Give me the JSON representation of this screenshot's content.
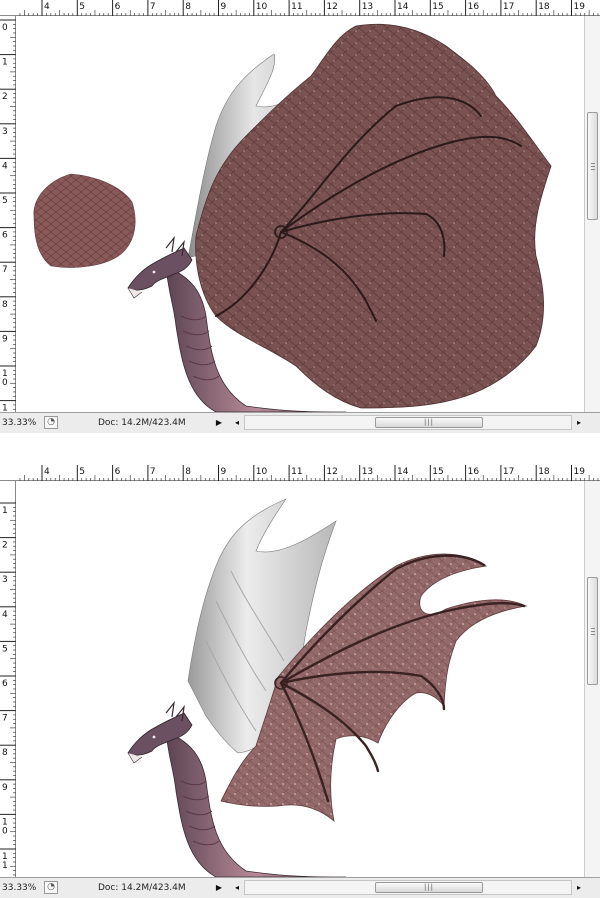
{
  "panels": [
    {
      "id": "before",
      "status": {
        "zoom": "33.33%",
        "doc": "Doc: 14.2M/423.4M"
      },
      "ruler_h_labels": [
        "4",
        "5",
        "6",
        "7",
        "8",
        "9",
        "10",
        "11",
        "12",
        "13",
        "14",
        "15",
        "16",
        "17",
        "18",
        "19"
      ],
      "ruler_v_labels": [
        "0",
        "1",
        "2",
        "3",
        "4",
        "5",
        "6",
        "7",
        "8",
        "9",
        "1 0",
        "1 1"
      ]
    },
    {
      "id": "after",
      "status": {
        "zoom": "33.33%",
        "doc": "Doc: 14.2M/423.4M"
      },
      "ruler_h_labels": [
        "4",
        "5",
        "6",
        "7",
        "8",
        "9",
        "10",
        "11",
        "12",
        "13",
        "14",
        "15",
        "16",
        "17",
        "18",
        "19"
      ],
      "ruler_v_labels": [
        "1",
        "2",
        "3",
        "4",
        "5",
        "6",
        "7",
        "8",
        "9",
        "1 0",
        "1 1"
      ]
    }
  ],
  "icons": {
    "scroll_left": "left-arrow-icon",
    "scroll_right": "right-arrow-icon",
    "status_menu": "play-triangle-icon",
    "status_button": "document-status-icon"
  },
  "colors": {
    "wing_skin": "#7a5050",
    "membrane_grey": "#c8c8c8",
    "dragon_body": "#8a6a78"
  }
}
